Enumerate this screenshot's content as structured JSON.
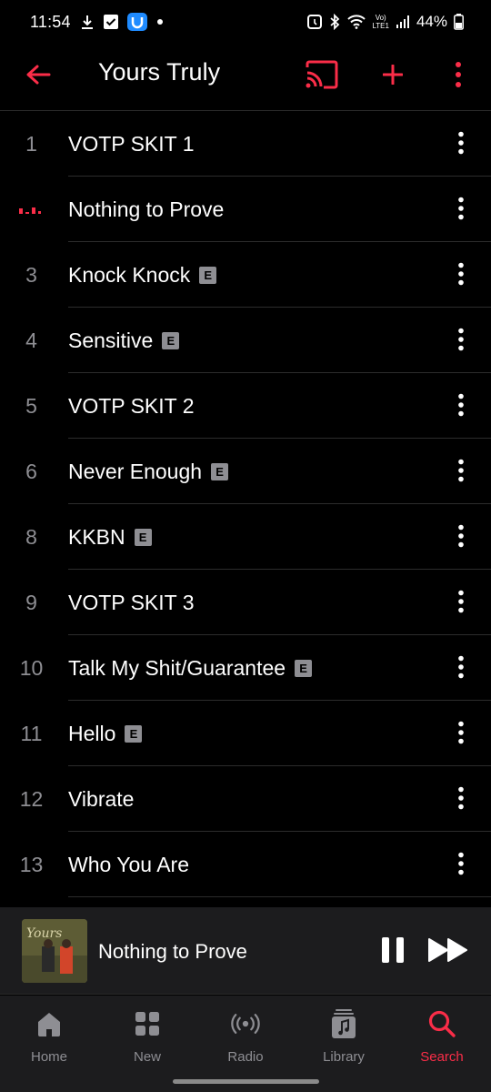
{
  "status_bar": {
    "time": "11:54",
    "lte_label": "LTE1",
    "battery": "44%"
  },
  "header": {
    "title": "Yours Truly"
  },
  "colors": {
    "accent": "#fa2d48",
    "background": "#000000",
    "surface": "#1c1c1e",
    "secondary_text": "#8e8e93"
  },
  "tracks": [
    {
      "number": "1",
      "title": "VOTP SKIT 1",
      "explicit": false,
      "playing": false
    },
    {
      "number": "",
      "title": "Nothing to Prove",
      "explicit": false,
      "playing": true
    },
    {
      "number": "3",
      "title": "Knock Knock",
      "explicit": true,
      "playing": false
    },
    {
      "number": "4",
      "title": "Sensitive",
      "explicit": true,
      "playing": false
    },
    {
      "number": "5",
      "title": "VOTP SKIT 2",
      "explicit": false,
      "playing": false
    },
    {
      "number": "6",
      "title": "Never Enough",
      "explicit": true,
      "playing": false
    },
    {
      "number": "8",
      "title": "KKBN",
      "explicit": true,
      "playing": false
    },
    {
      "number": "9",
      "title": "VOTP SKIT 3",
      "explicit": false,
      "playing": false
    },
    {
      "number": "10",
      "title": "Talk My Shit/Guarantee",
      "explicit": true,
      "playing": false
    },
    {
      "number": "11",
      "title": "Hello",
      "explicit": true,
      "playing": false
    },
    {
      "number": "12",
      "title": "Vibrate",
      "explicit": false,
      "playing": false
    },
    {
      "number": "13",
      "title": "Who You Are",
      "explicit": false,
      "playing": false
    }
  ],
  "explicit_badge": "E",
  "now_playing": {
    "title": "Nothing to Prove",
    "artwork_text": "Yours"
  },
  "tabs": [
    {
      "label": "Home",
      "icon": "home-icon",
      "active": false
    },
    {
      "label": "New",
      "icon": "grid-icon",
      "active": false
    },
    {
      "label": "Radio",
      "icon": "radio-icon",
      "active": false
    },
    {
      "label": "Library",
      "icon": "library-icon",
      "active": false
    },
    {
      "label": "Search",
      "icon": "search-icon",
      "active": true
    }
  ]
}
